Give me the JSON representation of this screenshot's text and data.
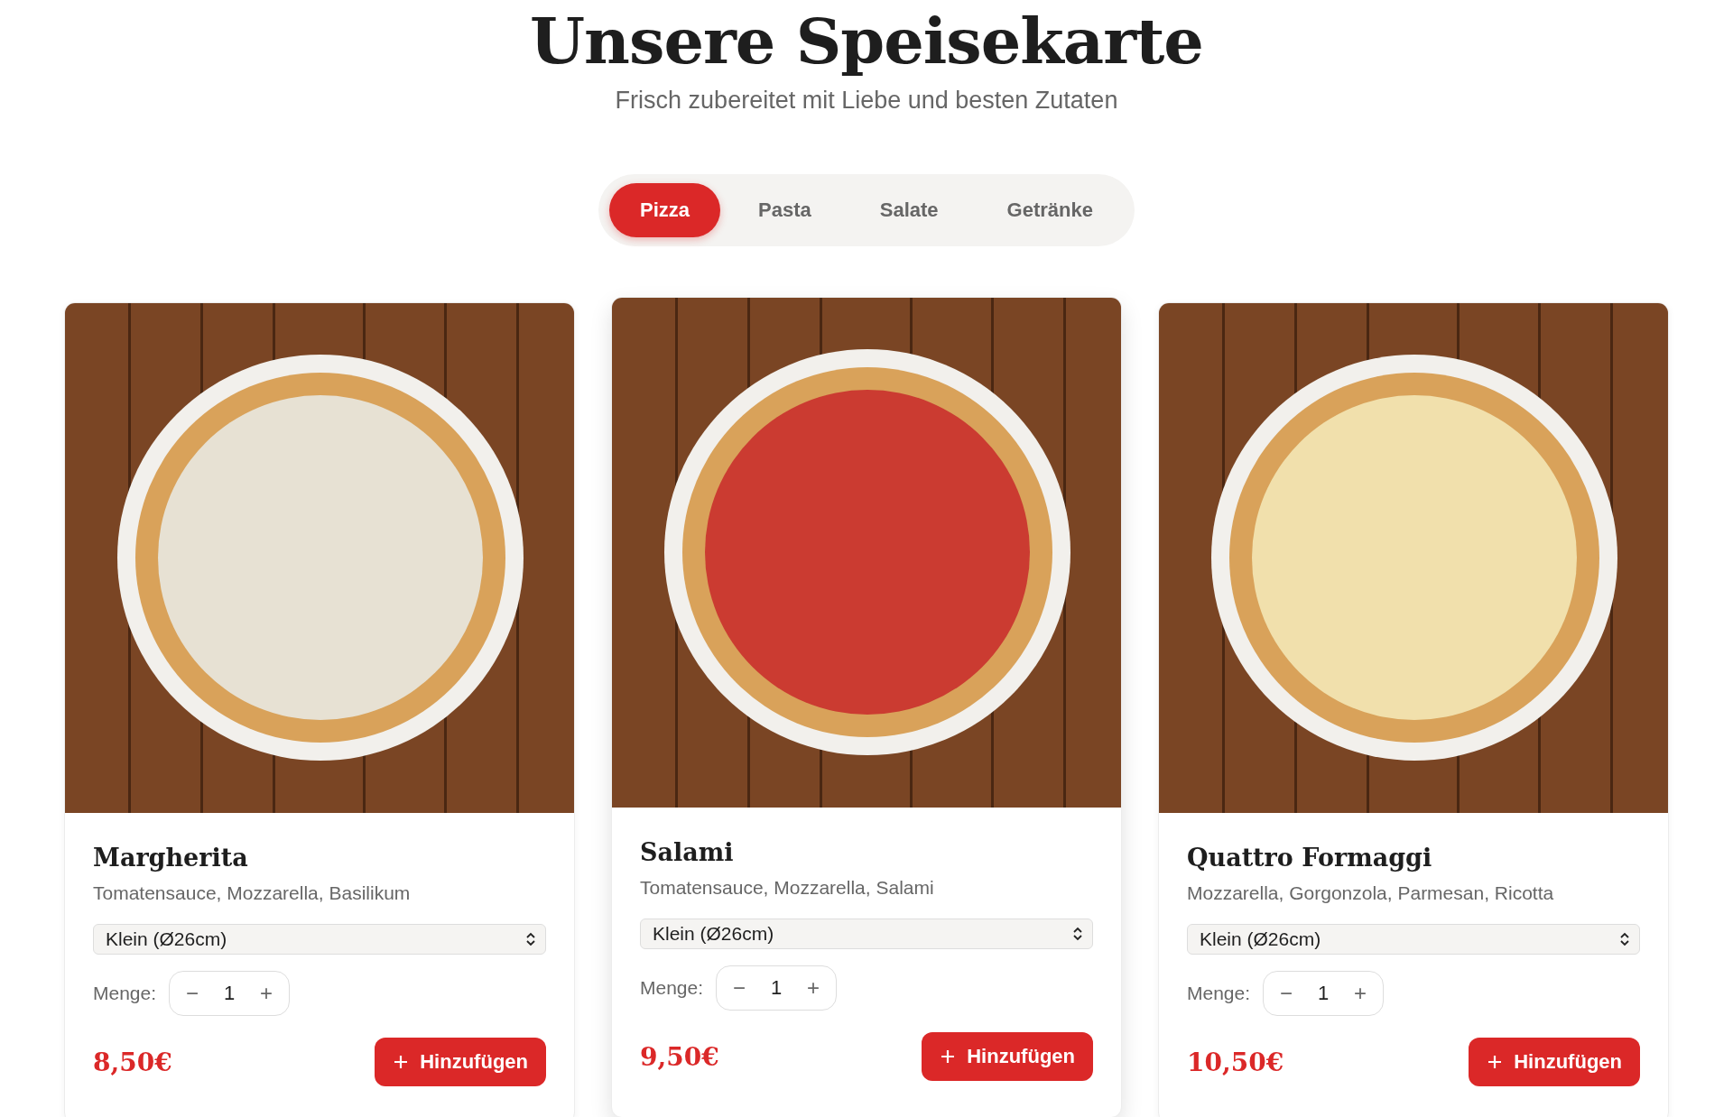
{
  "header": {
    "title": "Unsere Speisekarte",
    "subtitle": "Frisch zubereitet mit Liebe und besten Zutaten"
  },
  "tabs": [
    {
      "label": "Pizza",
      "selected": true
    },
    {
      "label": "Pasta",
      "selected": false
    },
    {
      "label": "Salate",
      "selected": false
    },
    {
      "label": "Getränke",
      "selected": false
    }
  ],
  "items": [
    {
      "name": "Margherita",
      "description": "Tomatensauce, Mozzarella, Basilikum",
      "size": "Klein (Ø26cm)",
      "quantity_label": "Menge:",
      "quantity": "1",
      "decrement": "−",
      "increment": "+",
      "price": "8,50€",
      "button": "Hinzufügen",
      "hovered": false
    },
    {
      "name": "Salami",
      "description": "Tomatensauce, Mozzarella, Salami",
      "size": "Klein (Ø26cm)",
      "quantity_label": "Menge:",
      "quantity": "1",
      "decrement": "−",
      "increment": "+",
      "price": "9,50€",
      "button": "Hinzufügen",
      "hovered": true
    },
    {
      "name": "Quattro Formaggi",
      "description": "Mozzarella, Gorgonzola, Parmesan, Ricotta",
      "size": "Klein (Ø26cm)",
      "quantity_label": "Menge:",
      "quantity": "1",
      "decrement": "−",
      "increment": "+",
      "price": "10,50€",
      "button": "Hinzufügen",
      "hovered": false
    }
  ]
}
